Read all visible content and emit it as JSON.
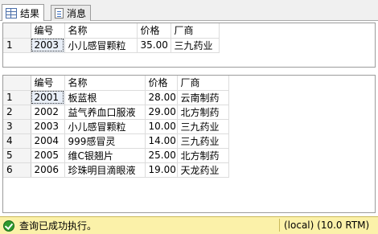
{
  "tabs": [
    {
      "label": "结果",
      "icon": "results-grid-icon",
      "active": true
    },
    {
      "label": "消息",
      "icon": "messages-document-icon",
      "active": false
    }
  ],
  "grid1": {
    "columns": [
      "编号",
      "名称",
      "价格",
      "厂商"
    ],
    "rows": [
      {
        "num": "1",
        "cells": [
          "2003",
          "小儿感冒颗粒",
          "35.00",
          "三九药业"
        ]
      }
    ]
  },
  "grid2": {
    "columns": [
      "编号",
      "名称",
      "价格",
      "厂商"
    ],
    "rows": [
      {
        "num": "1",
        "cells": [
          "2001",
          "板蓝根",
          "28.00",
          "云南制药"
        ]
      },
      {
        "num": "2",
        "cells": [
          "2002",
          "益气养血口服液",
          "29.00",
          "北方制药"
        ]
      },
      {
        "num": "3",
        "cells": [
          "2003",
          "小儿感冒颗粒",
          "10.00",
          "三九药业"
        ]
      },
      {
        "num": "4",
        "cells": [
          "2004",
          "999感冒灵",
          "14.00",
          "三九药业"
        ]
      },
      {
        "num": "5",
        "cells": [
          "2005",
          "维C银翘片",
          "25.00",
          "北方制药"
        ]
      },
      {
        "num": "6",
        "cells": [
          "2006",
          "珍珠明目滴眼液",
          "19.00",
          "天龙药业"
        ]
      }
    ]
  },
  "status": {
    "message": "查询已成功执行。",
    "server": "(local) (10.0 RTM)",
    "color": "#fbf1a9"
  }
}
